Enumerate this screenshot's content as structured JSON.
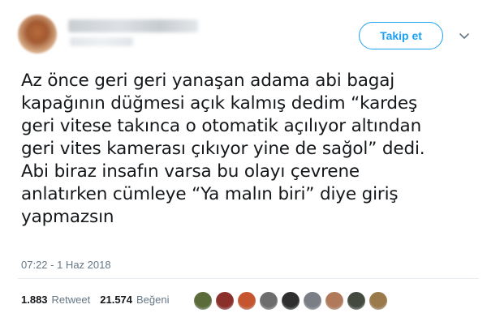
{
  "header": {
    "follow_label": "Takip et"
  },
  "tweet": {
    "lines": [
      "Az önce geri geri yanaşan adama abi bagaj",
      "kapağının düğmesi açık kalmış dedim “kardeş",
      "geri vitese takınca o otomatik açılıyor altından",
      "geri vites kamerası çıkıyor yine de sağol” dedi.",
      "Abi biraz insafın varsa bu olayı çevrene",
      "anlatırken cümleye “Ya malın biri” diye giriş",
      "yapmazsın"
    ],
    "timestamp": "07:22 - 1 Haz 2018"
  },
  "stats": {
    "retweet_count": "1.883",
    "retweet_label": "Retweet",
    "like_count": "21.574",
    "like_label": "Beğeni"
  },
  "likers": [
    {
      "color": "#5b6b3a"
    },
    {
      "color": "#8a2f2a"
    },
    {
      "color": "#c4552e"
    },
    {
      "color": "#6d6d6d"
    },
    {
      "color": "#2f2f2f"
    },
    {
      "color": "#7a7f86"
    },
    {
      "color": "#b07a5a"
    },
    {
      "color": "#444a3f"
    },
    {
      "color": "#9a7a4a"
    }
  ],
  "colors": {
    "accent": "#1da1f2",
    "text": "#14171a",
    "muted": "#657786"
  }
}
